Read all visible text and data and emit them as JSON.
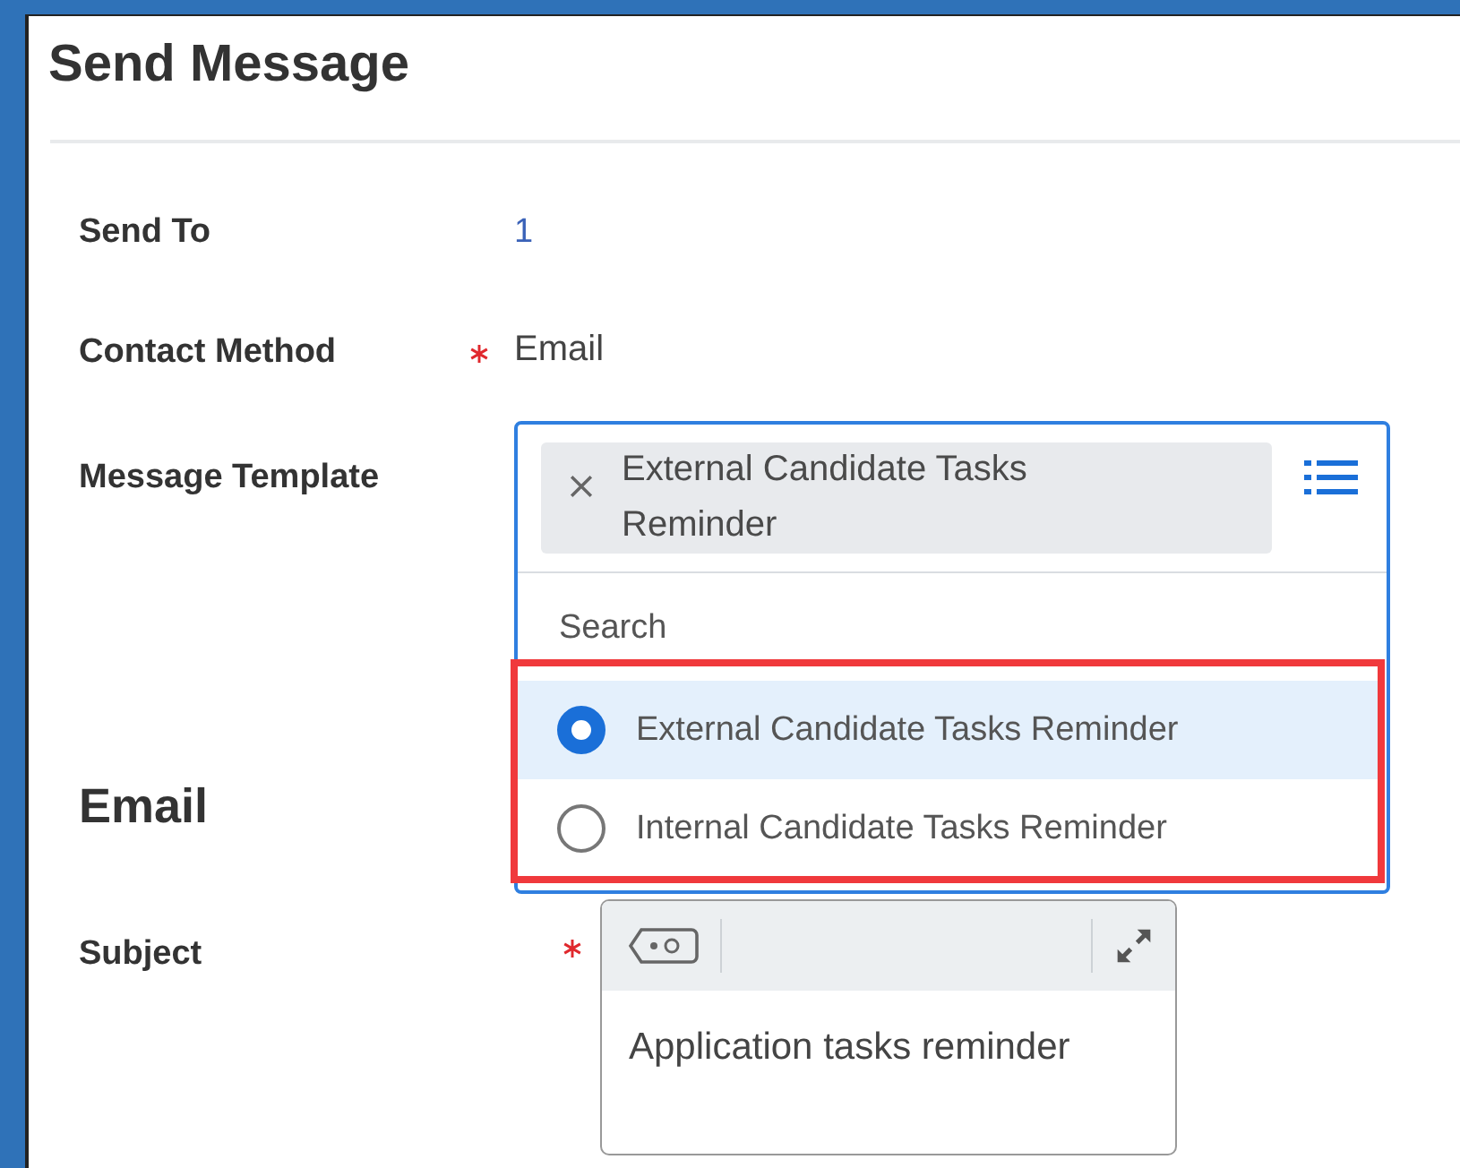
{
  "window_title": "Send Message",
  "fields": [
    {
      "label": "Send To",
      "required": false,
      "value": "1",
      "kind": "link"
    },
    {
      "label": "Contact Method",
      "required": true,
      "value": "Email",
      "kind": "text"
    }
  ],
  "message_template": {
    "label": "Message Template",
    "chip": "External Candidate Tasks Reminder",
    "search": {
      "placeholder": "Search"
    },
    "options_highlighted": true,
    "options": [
      {
        "label": "External Candidate Tasks Reminder",
        "selected": true
      },
      {
        "label": "Internal Candidate Tasks Reminder",
        "selected": false
      }
    ]
  },
  "email_section": {
    "heading": "Email",
    "subject": {
      "label": "Subject",
      "required": true,
      "value": "Application tasks reminder"
    }
  }
}
